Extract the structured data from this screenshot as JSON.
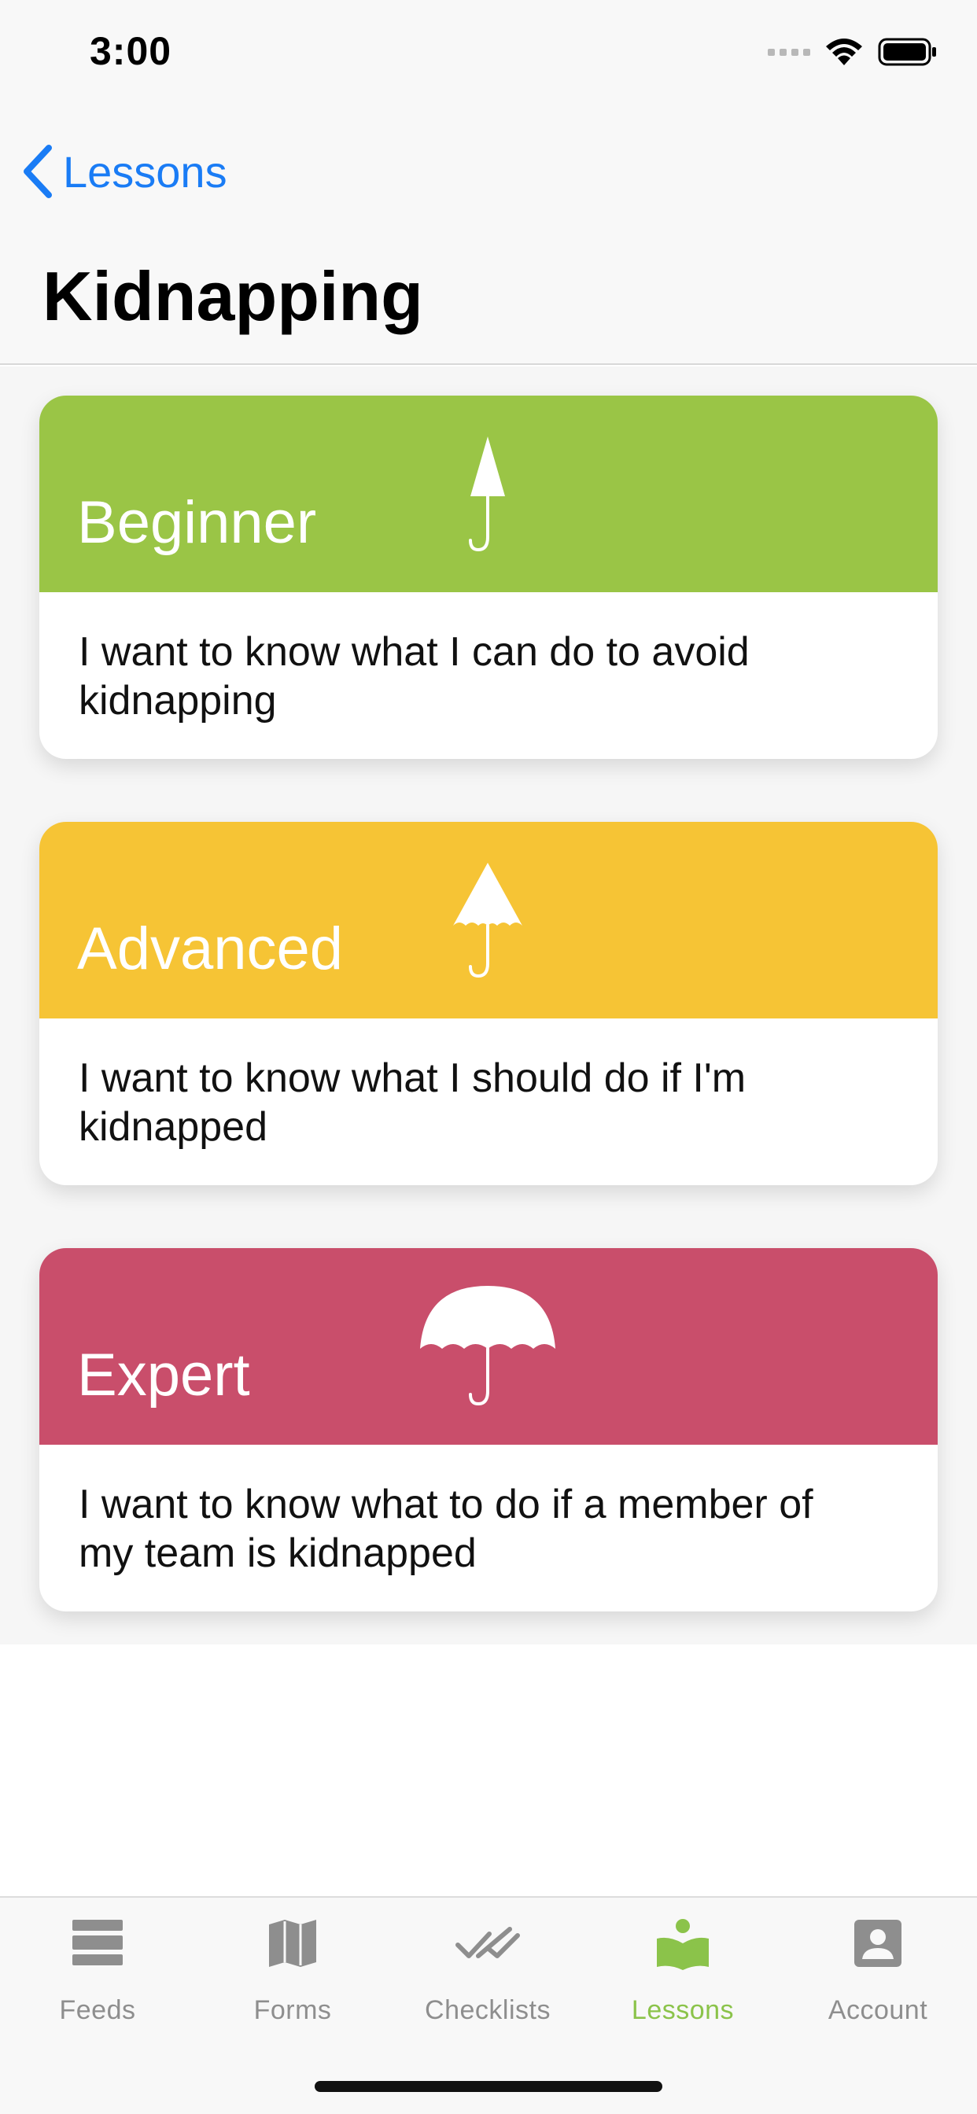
{
  "status_bar": {
    "time": "3:00"
  },
  "nav": {
    "back_label": "Lessons",
    "title": "Kidnapping"
  },
  "cards": [
    {
      "level": "Beginner",
      "description": "I want to know what I can do to avoid kidnapping",
      "color": "#9ac546",
      "icon": "closed-umbrella-icon"
    },
    {
      "level": "Advanced",
      "description": "I want to know what I should do if I'm kidnapped",
      "color": "#f6c435",
      "icon": "half-open-umbrella-icon"
    },
    {
      "level": "Expert",
      "description": "I want to know what to do if a member of my team is kidnapped",
      "color": "#c94e6b",
      "icon": "open-umbrella-icon"
    }
  ],
  "tabbar": {
    "items": [
      {
        "label": "Feeds",
        "icon": "feeds-icon",
        "active": false
      },
      {
        "label": "Forms",
        "icon": "map-icon",
        "active": false
      },
      {
        "label": "Checklists",
        "icon": "double-check-icon",
        "active": false
      },
      {
        "label": "Lessons",
        "icon": "reading-book-icon",
        "active": true
      },
      {
        "label": "Account",
        "icon": "account-icon",
        "active": false
      }
    ],
    "active_color": "#8bc34a",
    "inactive_color": "#8e8e8e"
  }
}
